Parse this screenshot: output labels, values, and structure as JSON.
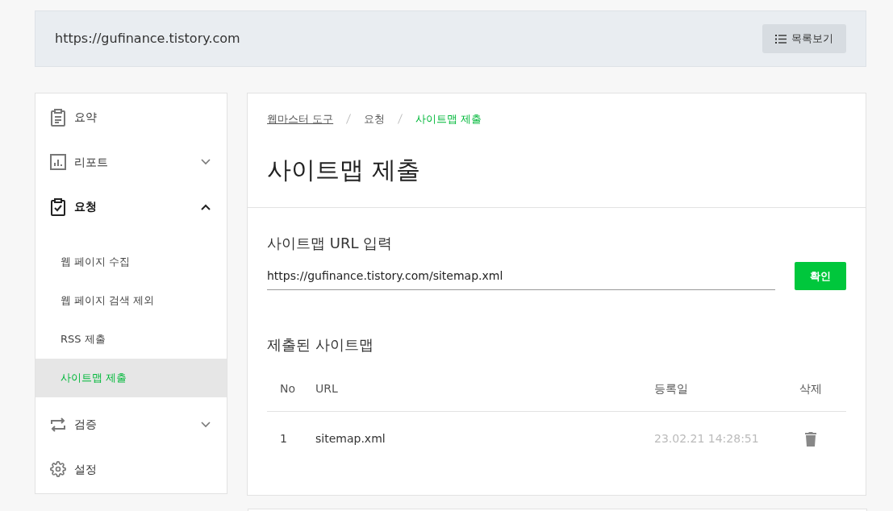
{
  "site_bar": {
    "url": "https://gufinance.tistory.com",
    "list_button": "목록보기"
  },
  "sidebar": {
    "items": [
      {
        "label": "요약",
        "selected": false
      },
      {
        "label": "리포트",
        "selected": false,
        "expanded": false
      },
      {
        "label": "요청",
        "selected": true,
        "expanded": true,
        "children": [
          {
            "label": "웹 페이지 수집",
            "selected": false
          },
          {
            "label": "웹 페이지 검색 제외",
            "selected": false
          },
          {
            "label": "RSS 제출",
            "selected": false
          },
          {
            "label": "사이트맵 제출",
            "selected": true
          }
        ]
      },
      {
        "label": "검증",
        "selected": false,
        "expanded": false
      },
      {
        "label": "설정",
        "selected": false
      }
    ]
  },
  "breadcrumb": [
    {
      "label": "웹마스터 도구",
      "kind": "link"
    },
    {
      "label": "요청",
      "kind": "text"
    },
    {
      "label": "사이트맵 제출",
      "kind": "current"
    }
  ],
  "title": "사이트맵 제출",
  "url_form": {
    "label": "사이트맵 URL 입력",
    "value": "https://gufinance.tistory.com/sitemap.xml",
    "button": "확인"
  },
  "submitted": {
    "title": "제출된 사이트맵",
    "columns": [
      "No",
      "URL",
      "등록일",
      "삭제"
    ],
    "rows": [
      {
        "no": "1",
        "url": "sitemap.xml",
        "date": "23.02.21 14:28:51"
      }
    ]
  }
}
